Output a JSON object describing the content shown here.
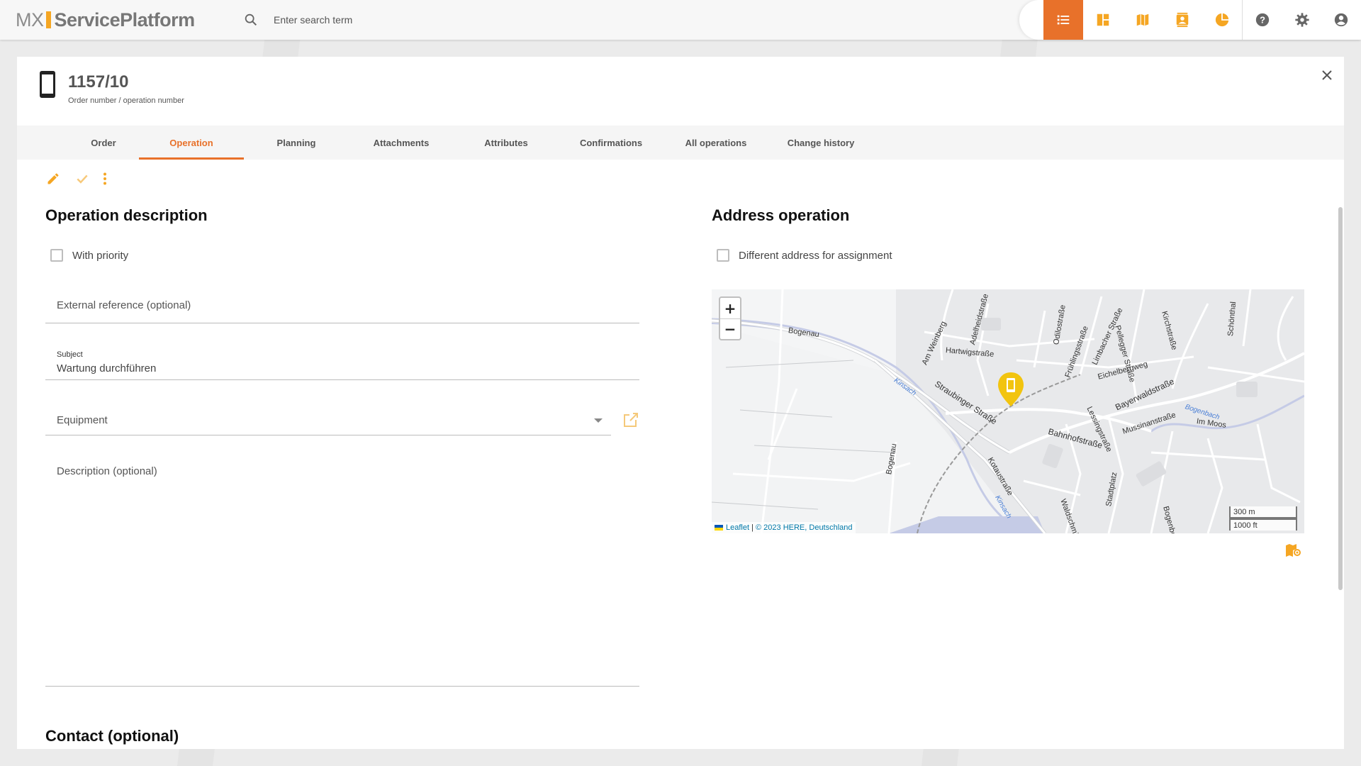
{
  "app": {
    "logo_prefix": "MX",
    "logo_name": "ServicePlatform"
  },
  "search": {
    "placeholder": "Enter search term"
  },
  "nav": {
    "items": [
      {
        "icon": "list-icon",
        "active": true
      },
      {
        "icon": "dashboard-icon",
        "active": false
      },
      {
        "icon": "map-icon",
        "active": false
      },
      {
        "icon": "contacts-icon",
        "active": false
      },
      {
        "icon": "pie-chart-icon",
        "active": false
      },
      {
        "icon": "help-icon",
        "active": false
      },
      {
        "icon": "settings-icon",
        "active": false
      },
      {
        "icon": "account-icon",
        "active": false
      }
    ],
    "active_color": "#e8712a",
    "icon_color": "#f5a623"
  },
  "record": {
    "title": "1157/10",
    "subtitle": "Order number / operation number"
  },
  "tabs": [
    {
      "label": "Order"
    },
    {
      "label": "Operation"
    },
    {
      "label": "Planning"
    },
    {
      "label": "Attachments"
    },
    {
      "label": "Attributes"
    },
    {
      "label": "Confirmations"
    },
    {
      "label": "All operations"
    },
    {
      "label": "Change history"
    }
  ],
  "active_tab": "Operation",
  "operation": {
    "title": "Operation description",
    "with_priority_label": "With priority",
    "with_priority_checked": false,
    "external_reference_placeholder": "External reference (optional)",
    "subject_label": "Subject",
    "subject_value": "Wartung durchführen",
    "equipment_placeholder": "Equipment",
    "description_placeholder": "Description (optional)"
  },
  "address": {
    "title": "Address operation",
    "different_address_label": "Different address for assignment",
    "different_address_checked": false
  },
  "map": {
    "zoom_in": "+",
    "zoom_out": "−",
    "attribution_leaflet": "Leaflet",
    "attribution_sep": " | ",
    "attribution_copy": "© 2023 HERE, Deutschland",
    "scale_metric": "300 m",
    "scale_imperial": "1000 ft",
    "street_labels": [
      "Bogenau",
      "Hartwigstraße",
      "Am Weinberg",
      "Adelheidstraße",
      "Odilostraße",
      "Frühlingsstraße",
      "Limbacher Straße",
      "Schönthal",
      "Eichelbergweg",
      "Straubinger Straße",
      "Bayerwaldstraße",
      "Lessingstraße",
      "Bahnhofstraße",
      "Mussinanstraße",
      "Im Moos",
      "Kotaustraße",
      "Bogenau",
      "Stadtplatz",
      "Waldschmidt",
      "Bogenberg",
      "Pellegger Straße",
      "Kirchstraße"
    ],
    "water_labels": [
      "Kinsach",
      "Kinsach",
      "Bogenbach"
    ],
    "marker_color": "#f2c40f"
  },
  "contact": {
    "title": "Contact (optional)"
  }
}
